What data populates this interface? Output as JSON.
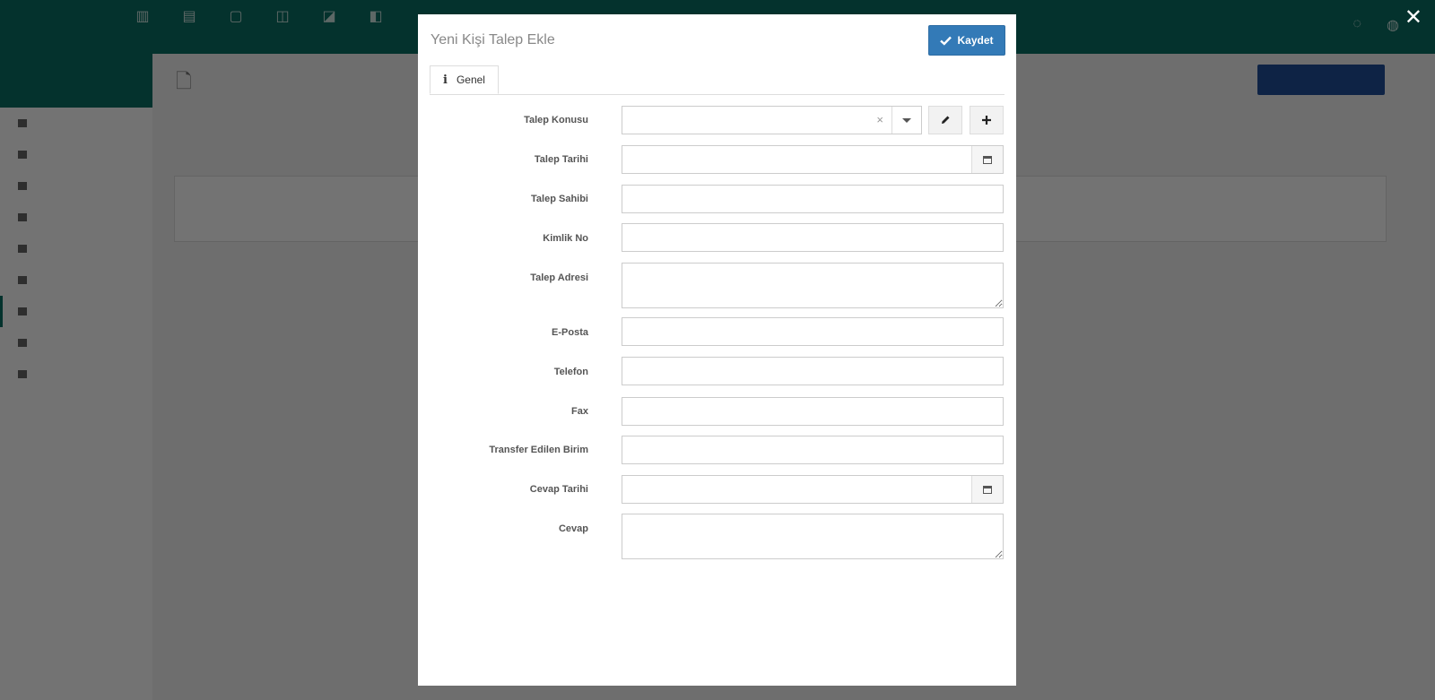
{
  "modal": {
    "title": "Yeni Kişi Talep Ekle",
    "save_label": "Kaydet",
    "tab_label": "Genel",
    "fields": {
      "talep_konusu": "Talep Konusu",
      "talep_tarihi": "Talep Tarihi",
      "talep_sahibi": "Talep Sahibi",
      "kimlik_no": "Kimlik No",
      "talep_adresi": "Talep Adresi",
      "e_posta": "E-Posta",
      "telefon": "Telefon",
      "fax": "Fax",
      "transfer_edilen_birim": "Transfer Edilen Birim",
      "cevap_tarihi": "Cevap Tarihi",
      "cevap": "Cevap"
    },
    "select_clear": "×",
    "close_symbol": "✕"
  },
  "icons": {
    "check": "check-icon",
    "pencil": "pencil-icon",
    "plus": "plus-icon",
    "calendar": "calendar-icon",
    "info": "info-icon",
    "close": "close-icon"
  },
  "colors": {
    "topbar": "#0b6f64",
    "primary_button": "#337ab7",
    "background_button": "#1f4f9a"
  }
}
